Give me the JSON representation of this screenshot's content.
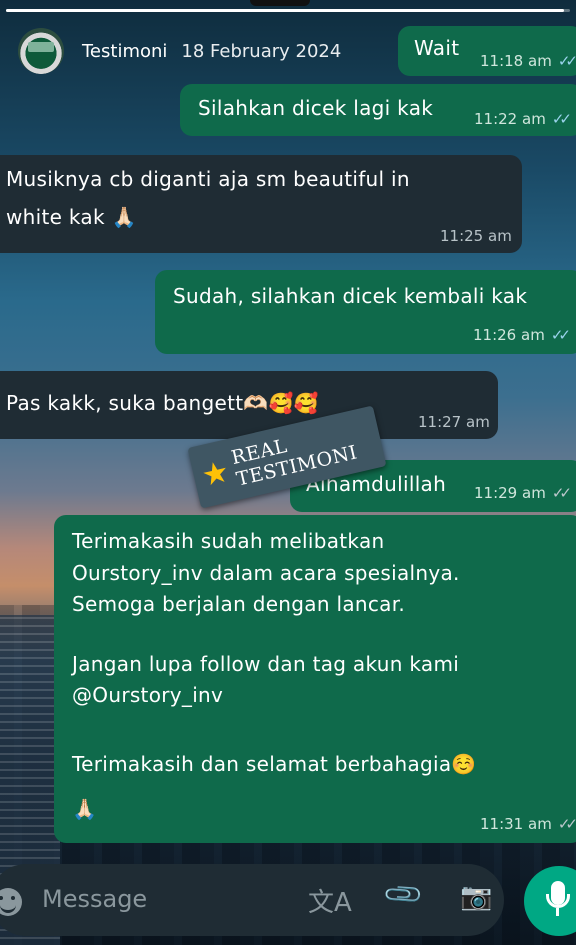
{
  "header": {
    "name": "Testimoni",
    "date": "18 February 2024"
  },
  "status": {
    "progress": 0.99
  },
  "messages": [
    {
      "dir": "out",
      "text": "Wait",
      "time": "11:18 am",
      "ticks": "read"
    },
    {
      "dir": "out",
      "text": "Silahkan dicek lagi kak",
      "time": "11:22 am",
      "ticks": "read"
    },
    {
      "dir": "in",
      "lines": [
        "Musiknya cb diganti aja sm beautiful in",
        "white kak 🙏🏻"
      ],
      "time": "11:25 am"
    },
    {
      "dir": "out",
      "text": "Sudah, silahkan dicek kembali kak",
      "time": "11:26 am",
      "ticks": "read"
    },
    {
      "dir": "in",
      "text": "Pas kakk, suka bangett🫶🏻🥰🥰",
      "time": "11:27 am"
    },
    {
      "dir": "out",
      "text": "Alhamdulillah",
      "time": "11:29 am",
      "ticks": "delivered"
    },
    {
      "dir": "out",
      "lines": [
        "Terimakasih sudah melibatkan",
        "Ourstory_inv dalam acara spesialnya.",
        "Semoga berjalan dengan lancar.",
        "",
        "Jangan lupa follow dan tag akun kami",
        "@Ourstory_inv",
        "",
        "Terimakasih dan selamat berbahagia☺️",
        "🙏🏻"
      ],
      "time": "11:31 am",
      "ticks": "delivered"
    }
  ],
  "sticker": {
    "text": "REAL TESTIMONI"
  },
  "composer": {
    "placeholder": "Message"
  },
  "icons": {
    "emoji": "emoji-icon",
    "translate": "translate-icon",
    "attach": "paperclip-icon",
    "camera": "camera-icon",
    "mic": "mic-icon"
  },
  "colors": {
    "outgoing": "#0f6a4b",
    "incoming": "#1f2c34",
    "read_ticks": "#9ad3ec",
    "mic": "#00a884"
  }
}
